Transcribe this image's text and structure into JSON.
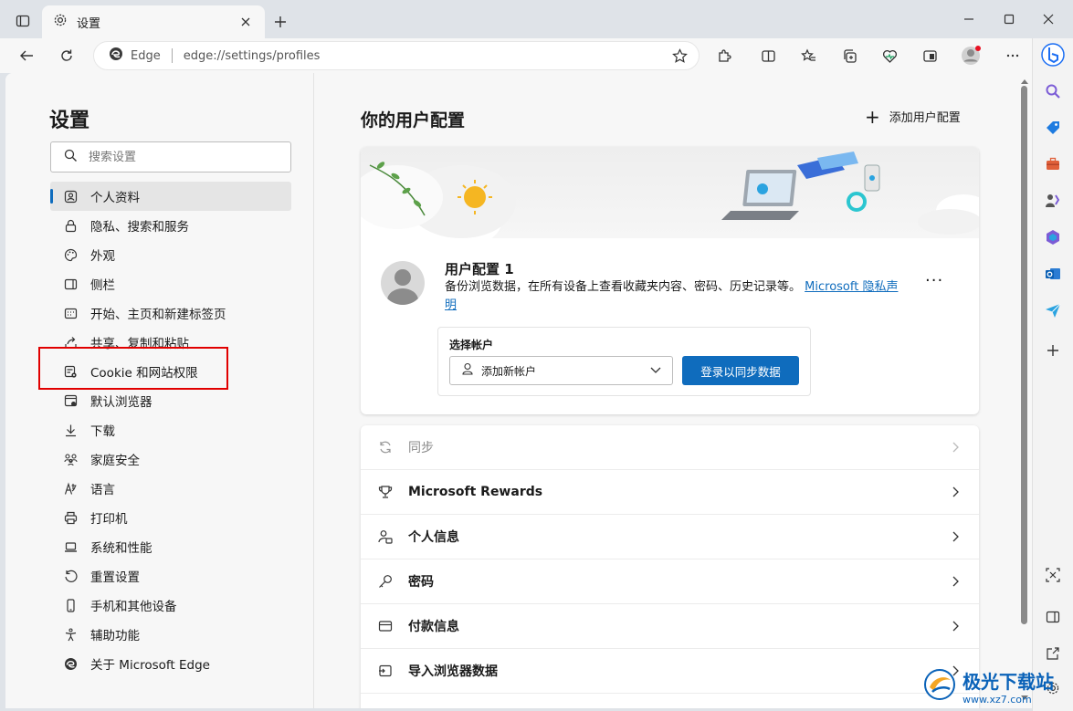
{
  "browser": {
    "tab_title": "设置",
    "address_site": "Edge",
    "address_url": "edge://settings/profiles"
  },
  "nav": {
    "title": "设置",
    "search_placeholder": "搜索设置",
    "items": [
      {
        "label": "个人资料",
        "icon": "profile-icon"
      },
      {
        "label": "隐私、搜索和服务",
        "icon": "lock-icon"
      },
      {
        "label": "外观",
        "icon": "palette-icon"
      },
      {
        "label": "侧栏",
        "icon": "sidebar-icon"
      },
      {
        "label": "开始、主页和新建标签页",
        "icon": "home-icon"
      },
      {
        "label": "共享、复制和粘贴",
        "icon": "share-icon"
      },
      {
        "label": "Cookie 和网站权限",
        "icon": "cookie-icon"
      },
      {
        "label": "默认浏览器",
        "icon": "browser-icon"
      },
      {
        "label": "下载",
        "icon": "download-icon"
      },
      {
        "label": "家庭安全",
        "icon": "family-icon"
      },
      {
        "label": "语言",
        "icon": "language-icon"
      },
      {
        "label": "打印机",
        "icon": "printer-icon"
      },
      {
        "label": "系统和性能",
        "icon": "laptop-icon"
      },
      {
        "label": "重置设置",
        "icon": "reset-icon"
      },
      {
        "label": "手机和其他设备",
        "icon": "phone-icon"
      },
      {
        "label": "辅助功能",
        "icon": "accessibility-icon"
      },
      {
        "label": "关于 Microsoft Edge",
        "icon": "edge-logo-icon"
      }
    ]
  },
  "main": {
    "title": "你的用户配置",
    "add_profile": "添加用户配置",
    "profile": {
      "name": "用户配置 1",
      "desc": "备份浏览数据，在所有设备上查看收藏夹内容、密码、历史记录等。",
      "privacy_link": "Microsoft 隐私声明",
      "account_label": "选择帐户",
      "account_select": "添加新帐户",
      "sync_button": "登录以同步数据"
    },
    "rows": [
      {
        "label": "同步",
        "icon": "sync-icon",
        "disabled": true
      },
      {
        "label": "Microsoft Rewards",
        "icon": "trophy-icon"
      },
      {
        "label": "个人信息",
        "icon": "person-card-icon"
      },
      {
        "label": "密码",
        "icon": "key-icon"
      },
      {
        "label": "付款信息",
        "icon": "credit-card-icon"
      },
      {
        "label": "导入浏览器数据",
        "icon": "import-icon"
      }
    ]
  },
  "watermark": {
    "title": "极光下载站",
    "url": "www.xz7.com"
  },
  "colors": {
    "accent": "#0f6cbd",
    "highlight": "#e10000"
  }
}
